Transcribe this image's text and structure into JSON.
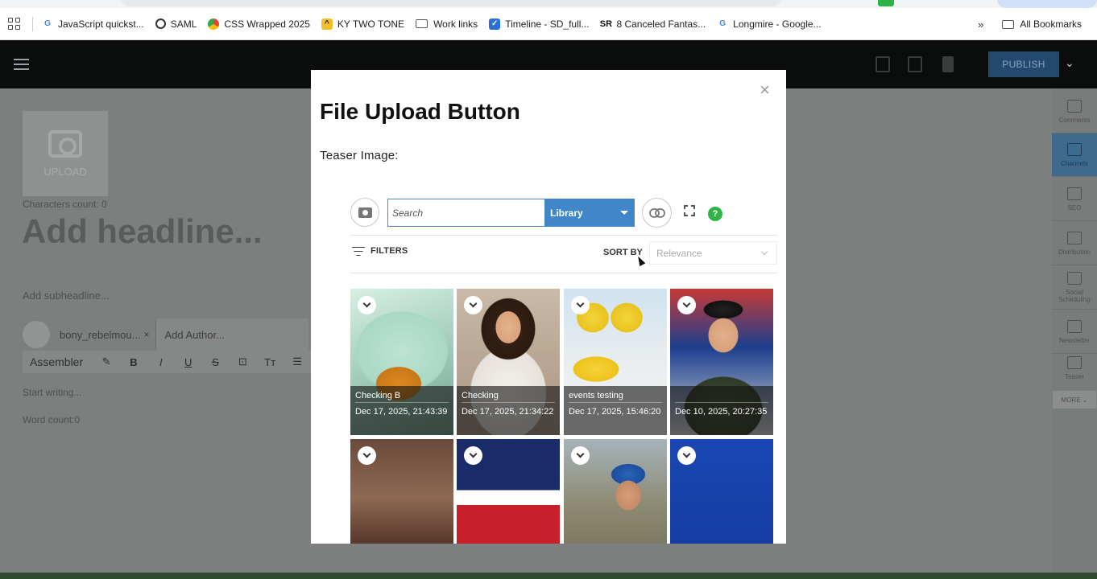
{
  "bookmarks": {
    "items": [
      {
        "label": "JavaScript quickst...",
        "icon": "google-icon"
      },
      {
        "label": "SAML",
        "icon": "globe-icon"
      },
      {
        "label": "CSS Wrapped 2025",
        "icon": "chrome-icon"
      },
      {
        "label": "KY TWO TONE",
        "icon": "cat-icon"
      },
      {
        "label": "Work links",
        "icon": "folder-icon"
      },
      {
        "label": "Timeline - SD_full...",
        "icon": "check-icon"
      },
      {
        "label": "8 Canceled Fantas...",
        "icon": "sr-icon"
      },
      {
        "label": "Longmire - Google...",
        "icon": "google-icon"
      }
    ],
    "more": "»",
    "all_bookmarks": "All Bookmarks"
  },
  "header": {
    "publish_label": "PUBLISH",
    "caret": "⌄"
  },
  "editor": {
    "upload_label": "UPLOAD",
    "characters_count": "Characters count: 0",
    "headline_placeholder": "Add headline...",
    "subheadline_placeholder": "Add subheadline...",
    "author_name": "bony_rebelmou...",
    "author_remove": "×",
    "add_author_placeholder": "Add Author...",
    "toolbar": {
      "assembler": "Assembler",
      "buttons": [
        "✎",
        "B",
        "I",
        "U",
        "S",
        "⊡",
        "Tт",
        "☰"
      ]
    },
    "body_placeholder": "Start writing...",
    "word_count": "Word count:0"
  },
  "rail": {
    "items": [
      {
        "label": "Comments"
      },
      {
        "label": "Channels"
      },
      {
        "label": "SEO"
      },
      {
        "label": "Distribution"
      },
      {
        "label": "Social Scheduling"
      },
      {
        "label": "Newsletter"
      },
      {
        "label": "Teaser"
      }
    ],
    "more": "MORE ⌄"
  },
  "modal": {
    "close": "×",
    "title": "File Upload Button",
    "teaser_label": "Teaser Image:",
    "search_placeholder": "Search",
    "library_label": "Library",
    "link_icon": "⊖",
    "help": "?",
    "filters_label": "FILTERS",
    "sort_by_label": "SORT BY",
    "sort_value": "Relevance",
    "assets": [
      {
        "title": "Checking B",
        "date": "Dec 17, 2025, 21:43:39"
      },
      {
        "title": "Checking",
        "date": "Dec 17, 2025, 21:34:22"
      },
      {
        "title": "events testing",
        "date": "Dec 17, 2025, 15:46:20"
      },
      {
        "title": "",
        "date": "Dec 10, 2025, 20:27:35"
      },
      {
        "title": "",
        "date": ""
      },
      {
        "title": "",
        "date": ""
      },
      {
        "title": "",
        "date": ""
      },
      {
        "title": "",
        "date": ""
      }
    ]
  },
  "colors": {
    "accent": "#3f87c9",
    "help_green": "#2fb347",
    "publish": "#234a6e"
  }
}
